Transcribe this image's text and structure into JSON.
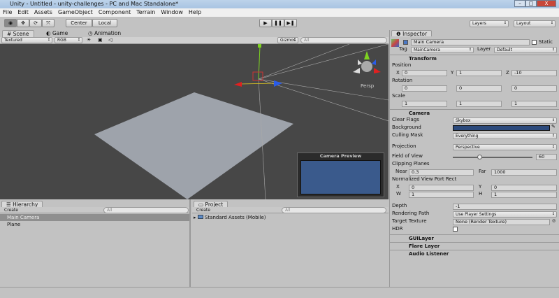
{
  "window": {
    "title": "Unity - Untitled - unity-challenges - PC and Mac Standalone*",
    "minimize": "–",
    "maximize": "□",
    "close": "X"
  },
  "menu": [
    "File",
    "Edit",
    "Assets",
    "GameObject",
    "Component",
    "Terrain",
    "Window",
    "Help"
  ],
  "toolbar": {
    "pivot": "Center",
    "space": "Local",
    "play": "▶",
    "pause": "❚❚",
    "step": "▶❚",
    "layers": "Layers",
    "layout": "Layout",
    "tools": [
      "◉",
      "✥",
      "⟳",
      "⤧"
    ]
  },
  "scene_tabs": [
    "Scene",
    "Game",
    "Animation"
  ],
  "scene_toolbar": {
    "render_mode": "Textured",
    "channel": "RGB",
    "gizmos": "Gizmos",
    "search": "All"
  },
  "scene": {
    "persp": "Persp",
    "camera_preview": "Camera Preview",
    "preview_color": "#3a5a8c"
  },
  "hierarchy": {
    "title": "Hierarchy",
    "create": "Create",
    "search": "All",
    "items": [
      "Main Camera",
      "Plane"
    ],
    "selected": 0
  },
  "project": {
    "title": "Project",
    "create": "Create",
    "search": "All",
    "items": [
      "Standard Assets (Mobile)"
    ]
  },
  "inspector": {
    "title": "Inspector",
    "object_name": "Main Camera",
    "static": "Static",
    "tag_label": "Tag",
    "tag": "MainCamera",
    "layer_label": "Layer",
    "layer": "Default",
    "transform": {
      "title": "Transform",
      "position_label": "Position",
      "rotation_label": "Rotation",
      "scale_label": "Scale",
      "position": [
        "0",
        "1",
        "-10"
      ],
      "rotation": [
        "0",
        "0",
        "0"
      ],
      "scale": [
        "1",
        "1",
        "1"
      ],
      "axes": [
        "X",
        "Y",
        "Z"
      ]
    },
    "camera": {
      "title": "Camera",
      "clear_flags_label": "Clear Flags",
      "clear_flags": "Skybox",
      "background_label": "Background",
      "background_color": "#2c4a7c",
      "culling_label": "Culling Mask",
      "culling": "Everything",
      "projection_label": "Projection",
      "projection": "Perspective",
      "fov_label": "Field of View",
      "fov": "60",
      "fov_fraction": 0.33,
      "clipping_label": "Clipping Planes",
      "near_label": "Near",
      "near": "0.3",
      "far_label": "Far",
      "far": "1000",
      "viewport_label": "Normalized View Port Rect",
      "vx_label": "X",
      "vx": "0",
      "vy_label": "Y",
      "vy": "0",
      "vw_label": "W",
      "vw": "1",
      "vh_label": "H",
      "vh": "1",
      "depth_label": "Depth",
      "depth": "-1",
      "rendering_label": "Rendering Path",
      "rendering": "Use Player Settings",
      "target_label": "Target Texture",
      "target": "None (Render Texture)",
      "hdr_label": "HDR"
    },
    "components": [
      "GUILayer",
      "Flare Layer",
      "Audio Listener"
    ]
  }
}
